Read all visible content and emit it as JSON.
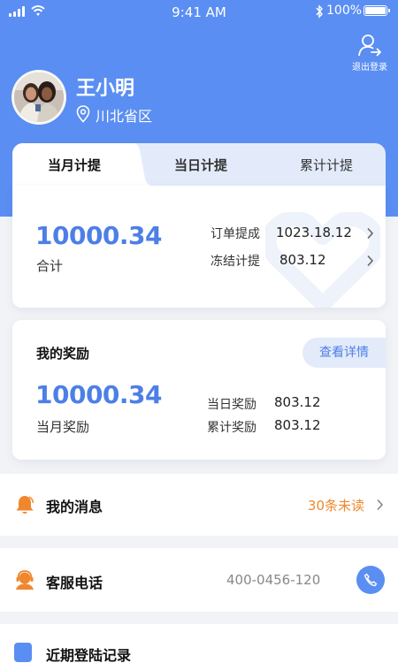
{
  "status_bar": {
    "time": "9:41 AM",
    "battery": "100%"
  },
  "header": {
    "logout_label": "退出登录",
    "user_name": "王小明",
    "location": "川北省区"
  },
  "tabs": [
    {
      "label": "当月计提",
      "active": true
    },
    {
      "label": "当日计提",
      "active": false
    },
    {
      "label": "累计计提",
      "active": false
    }
  ],
  "commission": {
    "total_amount": "10000.34",
    "total_label": "合计",
    "rows": [
      {
        "label": "订单提成",
        "value": "1023.18.12"
      },
      {
        "label": "冻结计提",
        "value": "803.12"
      }
    ]
  },
  "rewards": {
    "title": "我的奖励",
    "detail_button": "查看详情",
    "monthly_amount": "10000.34",
    "monthly_label": "当月奖励",
    "rows": [
      {
        "label": "当日奖励",
        "value": "803.12"
      },
      {
        "label": "累计奖励",
        "value": "803.12"
      }
    ]
  },
  "messages": {
    "title": "我的消息",
    "unread": "30条未读"
  },
  "service": {
    "title": "客服电话",
    "phone": "400-0456-120"
  },
  "login_records": {
    "title": "近期登陆记录"
  },
  "colors": {
    "primary": "#5a8ef2",
    "amount_blue": "#4d7fe6",
    "accent_orange": "#f0872e",
    "page_bg": "#f2f3f6"
  }
}
